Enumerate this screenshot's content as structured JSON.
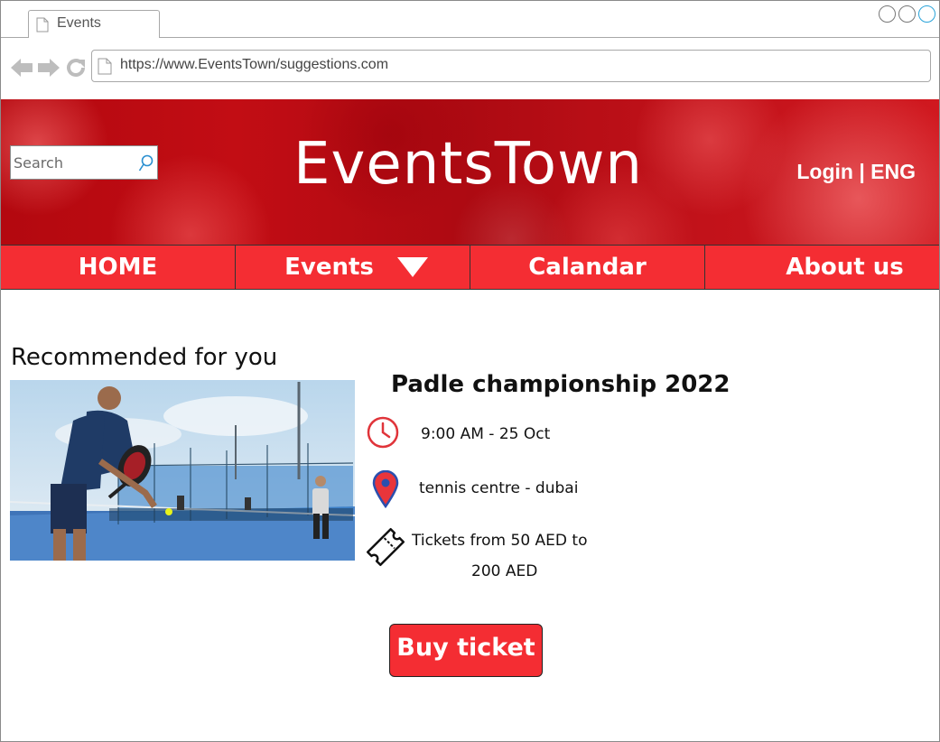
{
  "browser": {
    "tab_title": "Events",
    "url": "https://www.EventsTown/suggestions.com"
  },
  "header": {
    "search_placeholder": "Search",
    "brand": "EventsTown",
    "login_lang": "Login | ENG"
  },
  "nav": {
    "items": [
      {
        "label": "HOME"
      },
      {
        "label": "Events"
      },
      {
        "label": "Calandar"
      },
      {
        "label": "About us"
      }
    ]
  },
  "recommended": {
    "heading": "Recommended for you",
    "event": {
      "title": "Padle championship 2022",
      "time": "9:00 AM - 25 Oct",
      "location": "tennis centre - dubai",
      "tickets_line1": "Tickets from 50 AED to",
      "tickets_line2": "200 AED",
      "buy_label": "Buy ticket"
    }
  },
  "colors": {
    "brand_red": "#f42d33",
    "hero_red": "#c20d14",
    "text": "#111111"
  },
  "icons": [
    "page-icon",
    "back-arrow-icon",
    "forward-arrow-icon",
    "reload-icon",
    "search-icon",
    "caret-down-icon",
    "clock-icon",
    "location-pin-icon",
    "ticket-icon"
  ]
}
